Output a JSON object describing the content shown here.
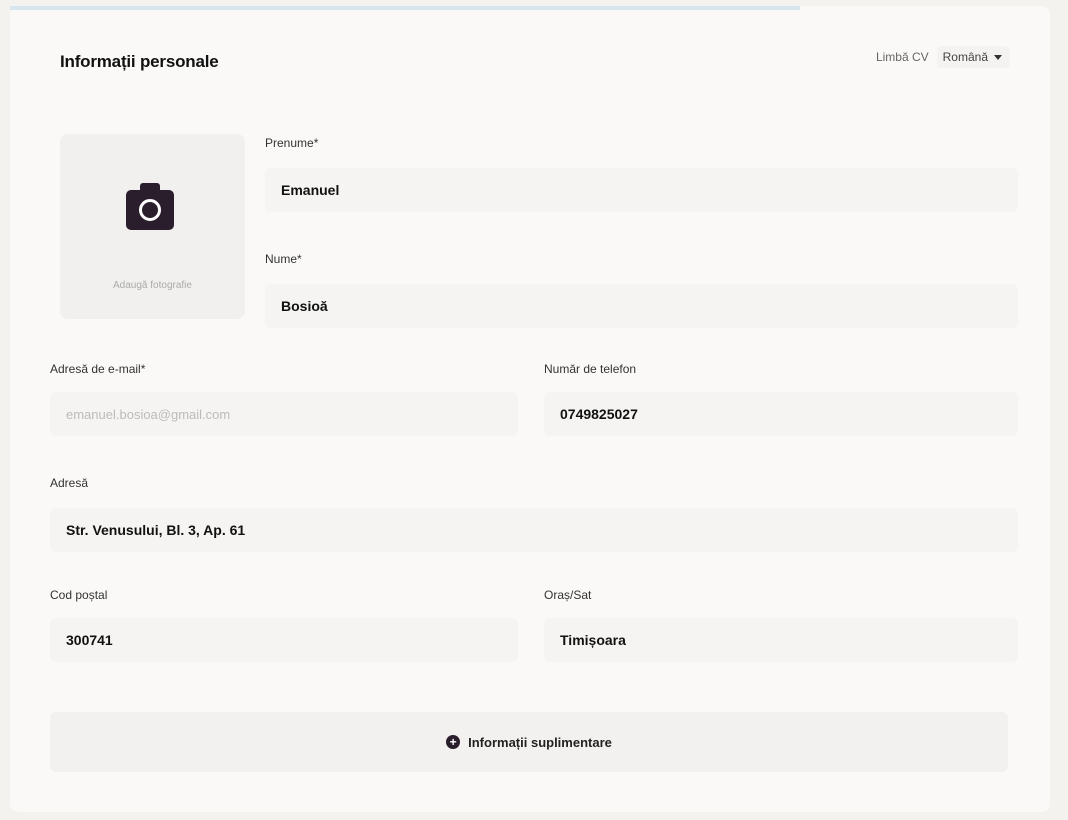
{
  "section": {
    "title": "Informații personale"
  },
  "cv_language": {
    "label": "Limbă CV",
    "selected": "Română"
  },
  "photo": {
    "label": "Adaugă fotografie"
  },
  "fields": {
    "first_name": {
      "label": "Prenume*",
      "value": "Emanuel"
    },
    "last_name": {
      "label": "Nume*",
      "value": "Bosioă"
    },
    "email": {
      "label": "Adresă de e-mail*",
      "value": "emanuel.bosioa@gmail.com"
    },
    "phone": {
      "label": "Număr de telefon",
      "value": "0749825027"
    },
    "address": {
      "label": "Adresă",
      "value": "Str. Venusului, Bl. 3, Ap. 61"
    },
    "postal_code": {
      "label": "Cod poștal",
      "value": "300741"
    },
    "city": {
      "label": "Oraș/Sat",
      "value": "Timișoara"
    }
  },
  "extra": {
    "icon": "plus-circle-icon",
    "label": "Informații suplimentare"
  }
}
